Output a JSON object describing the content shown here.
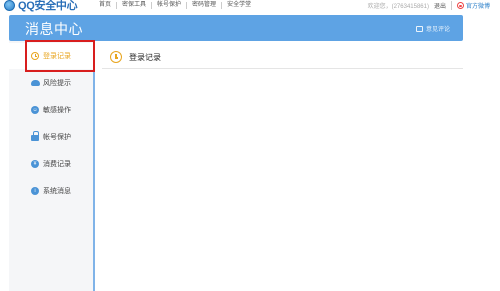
{
  "app": {
    "logo_text": "QQ安全中心"
  },
  "topnav": {
    "items": [
      "首页",
      "密保工具",
      "帐号保护",
      "密码管理",
      "安全学堂"
    ]
  },
  "topright": {
    "welcome": "欢迎您，(2763415861)",
    "logout": "退出",
    "weibo": "官方微博"
  },
  "header": {
    "title": "消息中心",
    "feedback": "意见评论"
  },
  "sidebar": {
    "items": [
      {
        "label": "登录记录",
        "icon": "clock-icon",
        "active": true
      },
      {
        "label": "风险提示",
        "icon": "cloud-icon",
        "active": false
      },
      {
        "label": "敏感操作",
        "icon": "face-icon",
        "active": false
      },
      {
        "label": "帐号保护",
        "icon": "lock-icon",
        "active": false
      },
      {
        "label": "消费记录",
        "icon": "coin-icon",
        "active": false
      },
      {
        "label": "系统消息",
        "icon": "info-icon",
        "active": false
      }
    ]
  },
  "content": {
    "title": "登录记录"
  },
  "colors": {
    "header_blue": "#5ea3e4",
    "active_orange": "#e8a51f",
    "highlight_red": "#d81e1e"
  }
}
